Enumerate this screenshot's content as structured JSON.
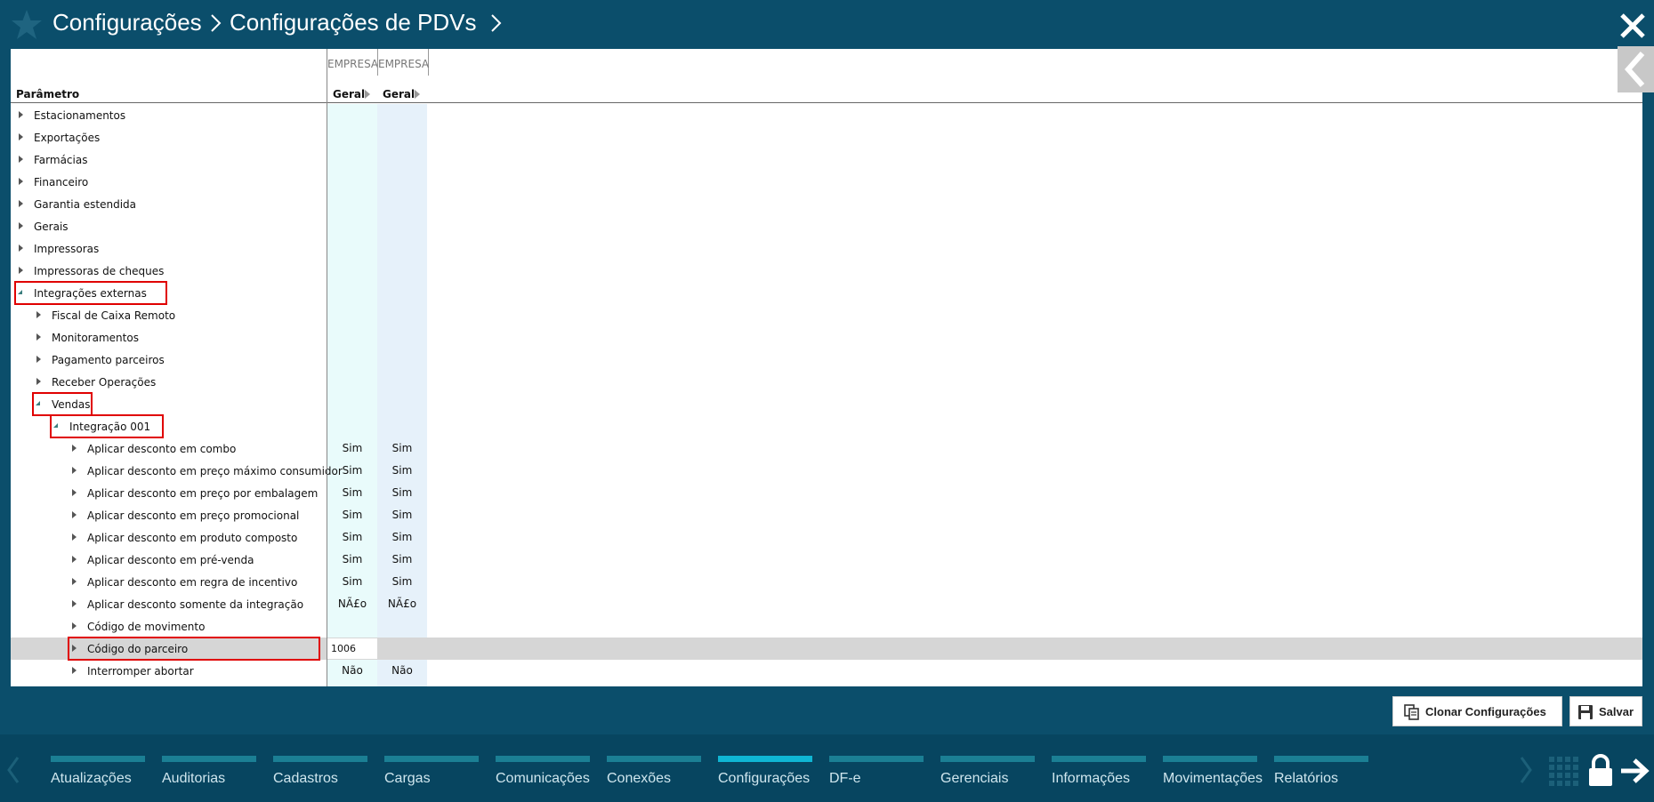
{
  "header": {
    "crumbs": [
      "Configurações",
      "Configurações de PDVs"
    ]
  },
  "table": {
    "group_headers": [
      "EMPRESA",
      "EMPRESA"
    ],
    "param_header": "Parâmetro",
    "col_headers": [
      "Geral",
      "Geral"
    ],
    "rows": [
      {
        "label": "Estacionamentos",
        "level": 0,
        "state": "closed",
        "v1": "",
        "v2": ""
      },
      {
        "label": "Exportações",
        "level": 0,
        "state": "closed",
        "v1": "",
        "v2": ""
      },
      {
        "label": "Farmácias",
        "level": 0,
        "state": "closed",
        "v1": "",
        "v2": ""
      },
      {
        "label": "Financeiro",
        "level": 0,
        "state": "closed",
        "v1": "",
        "v2": ""
      },
      {
        "label": "Garantia estendida",
        "level": 0,
        "state": "closed",
        "v1": "",
        "v2": ""
      },
      {
        "label": "Gerais",
        "level": 0,
        "state": "closed",
        "v1": "",
        "v2": ""
      },
      {
        "label": "Impressoras",
        "level": 0,
        "state": "closed",
        "v1": "",
        "v2": ""
      },
      {
        "label": "Impressoras de cheques",
        "level": 0,
        "state": "closed",
        "v1": "",
        "v2": ""
      },
      {
        "label": "Integrações externas",
        "level": 0,
        "state": "open",
        "v1": "",
        "v2": "",
        "highlight": true
      },
      {
        "label": "Fiscal de Caixa Remoto",
        "level": 1,
        "state": "closed",
        "v1": "",
        "v2": ""
      },
      {
        "label": "Monitoramentos",
        "level": 1,
        "state": "closed",
        "v1": "",
        "v2": ""
      },
      {
        "label": "Pagamento parceiros",
        "level": 1,
        "state": "closed",
        "v1": "",
        "v2": ""
      },
      {
        "label": "Receber Operações",
        "level": 1,
        "state": "closed",
        "v1": "",
        "v2": ""
      },
      {
        "label": "Vendas",
        "level": 1,
        "state": "open",
        "v1": "",
        "v2": "",
        "highlight": true
      },
      {
        "label": "Integração 001",
        "level": 2,
        "state": "open",
        "v1": "",
        "v2": "",
        "highlight": true
      },
      {
        "label": "Aplicar desconto em combo",
        "level": 3,
        "state": "closed",
        "v1": "Sim",
        "v2": "Sim"
      },
      {
        "label": "Aplicar desconto em preço máximo consumidor",
        "level": 3,
        "state": "closed",
        "v1": "Sim",
        "v2": "Sim"
      },
      {
        "label": "Aplicar desconto em preço por embalagem",
        "level": 3,
        "state": "closed",
        "v1": "Sim",
        "v2": "Sim"
      },
      {
        "label": "Aplicar desconto em preço promocional",
        "level": 3,
        "state": "closed",
        "v1": "Sim",
        "v2": "Sim"
      },
      {
        "label": "Aplicar desconto em produto composto",
        "level": 3,
        "state": "closed",
        "v1": "Sim",
        "v2": "Sim"
      },
      {
        "label": "Aplicar desconto em pré-venda",
        "level": 3,
        "state": "closed",
        "v1": "Sim",
        "v2": "Sim"
      },
      {
        "label": "Aplicar desconto em regra de incentivo",
        "level": 3,
        "state": "closed",
        "v1": "Sim",
        "v2": "Sim"
      },
      {
        "label": "Aplicar desconto somente da integração",
        "level": 3,
        "state": "closed",
        "v1": "NÃ£o",
        "v2": "NÃ£o"
      },
      {
        "label": "Código de movimento",
        "level": 3,
        "state": "closed",
        "v1": "",
        "v2": ""
      },
      {
        "label": "Código do parceiro",
        "level": 3,
        "state": "closed",
        "v1": "1006",
        "v2": "",
        "selected": true,
        "highlight": true
      },
      {
        "label": "Interromper abortar",
        "level": 3,
        "state": "closed",
        "v1": "Não",
        "v2": "Não"
      }
    ]
  },
  "actions": {
    "clone_label": "Clonar Configurações",
    "save_label": "Salvar"
  },
  "bottom_nav": {
    "items": [
      "Atualizações",
      "Auditorias",
      "Cadastros",
      "Cargas",
      "Comunicações",
      "Conexões",
      "Configurações",
      "DF-e",
      "Gerenciais",
      "Informações",
      "Movimentações",
      "Relatórios"
    ],
    "active": "Configurações"
  },
  "colors": {
    "header_bg": "#0b4e6b",
    "bottom_bg": "#074560",
    "nav_bar": "#1b7f94",
    "nav_active": "#0fb6d4",
    "highlight": "#e00000"
  }
}
